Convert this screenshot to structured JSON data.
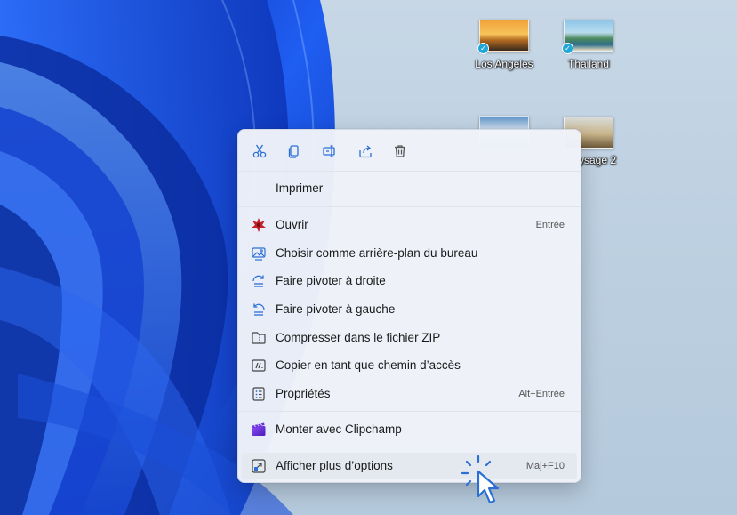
{
  "desktop": {
    "icons": [
      {
        "label": "Los Angeles",
        "synced": true
      },
      {
        "label": "Thailand",
        "synced": true
      },
      {
        "label": "",
        "synced": false
      },
      {
        "label": "ysage 2",
        "synced": false
      }
    ]
  },
  "context_menu": {
    "toolbar": [
      {
        "name": "cut-icon"
      },
      {
        "name": "copy-icon"
      },
      {
        "name": "rename-icon"
      },
      {
        "name": "share-icon"
      },
      {
        "name": "delete-icon"
      }
    ],
    "items": [
      {
        "label": "Imprimer",
        "accelerator": ""
      },
      {
        "label": "Ouvrir",
        "accelerator": "Entrée"
      },
      {
        "label": "Choisir comme arrière-plan du bureau",
        "accelerator": ""
      },
      {
        "label": "Faire pivoter à droite",
        "accelerator": ""
      },
      {
        "label": "Faire pivoter à gauche",
        "accelerator": ""
      },
      {
        "label": "Compresser dans le fichier ZIP",
        "accelerator": ""
      },
      {
        "label": "Copier en tant que chemin d’accès",
        "accelerator": ""
      },
      {
        "label": "Propriétés",
        "accelerator": "Alt+Entrée"
      },
      {
        "label": "Monter avec Clipchamp",
        "accelerator": ""
      },
      {
        "label": "Afficher plus d’options",
        "accelerator": "Maj+F10"
      }
    ]
  },
  "colors": {
    "accent": "#2b6fd6",
    "menu_bg": "#f0f3f9",
    "wallpaper_blue": "#1346d8"
  }
}
